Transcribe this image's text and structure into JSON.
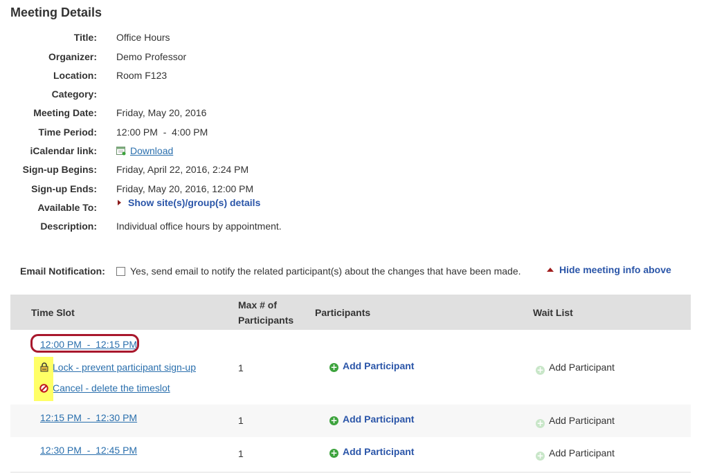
{
  "page": {
    "title": "Meeting Details"
  },
  "details": [
    {
      "label": "Title:",
      "value": "Office Hours"
    },
    {
      "label": "Organizer:",
      "value": "Demo Professor"
    },
    {
      "label": "Location:",
      "value": "Room F123"
    },
    {
      "label": "Category:",
      "value": ""
    },
    {
      "label": "Meeting Date:",
      "value": "Friday, May 20, 2016"
    },
    {
      "label": "Time Period:",
      "value": "12:00 PM  -  4:00 PM"
    },
    {
      "label": "iCalendar link:",
      "value": "Download"
    },
    {
      "label": "Sign-up Begins:",
      "value": "Friday, April 22, 2016, 2:24 PM"
    },
    {
      "label": "Sign-up Ends:",
      "value": "Friday, May 20, 2016, 12:00 PM"
    },
    {
      "label": "Available To:",
      "value": "Show site(s)/group(s) details"
    },
    {
      "label": "Description:",
      "value": "Individual office hours by appointment."
    }
  ],
  "email": {
    "label": "Email Notification:",
    "checkbox_text": "Yes, send email to notify the related participant(s) about the changes that have been made.",
    "hide_link": "Hide meeting info above"
  },
  "table": {
    "headers": {
      "time_slot": "Time Slot",
      "max_line1": "Max # of",
      "max_line2": "Participants",
      "participants": "Participants",
      "wait_list": "Wait List"
    },
    "rows": [
      {
        "time": "12:00 PM  -  12:15 PM",
        "max": "1",
        "add_participant": "Add Participant",
        "wait_list": "Add Participant",
        "lock_label": "Lock - prevent participant sign-up",
        "cancel_label": "Cancel - delete the timeslot"
      },
      {
        "time": "12:15 PM  -  12:30 PM",
        "max": "1",
        "add_participant": "Add Participant",
        "wait_list": "Add Participant"
      },
      {
        "time": "12:30 PM  -  12:45 PM",
        "max": "1",
        "add_participant": "Add Participant",
        "wait_list": "Add Participant"
      }
    ]
  },
  "colors": {
    "link": "#2a6fad",
    "bold_link": "#2a55a8",
    "header_bg": "#e0e0e0",
    "highlight": "#ffff66",
    "callout": "#a8172c",
    "add_icon": "#3da33d"
  },
  "icons": {
    "calendar": "calendar-icon",
    "expand": "triangle-right-icon",
    "collapse": "triangle-up-icon",
    "lock": "lock-icon",
    "cancel": "cancel-icon",
    "add": "plus-circle-icon"
  }
}
